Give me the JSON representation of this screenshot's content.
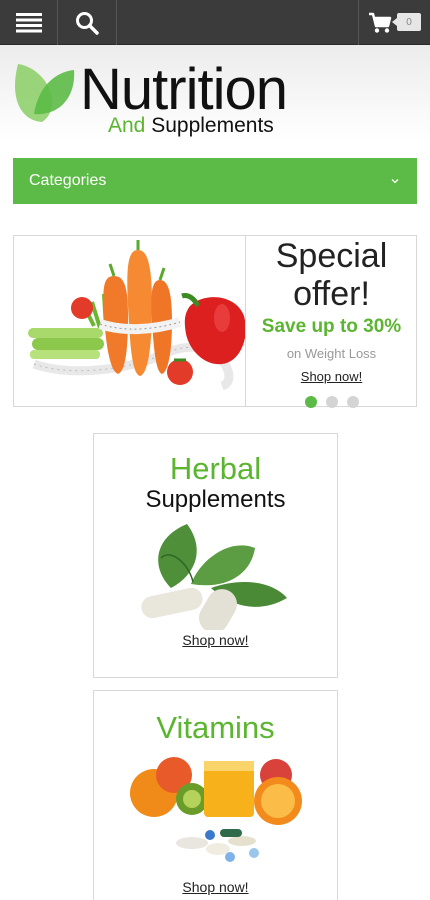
{
  "topbar": {
    "menu_icon": "hamburger-menu-icon",
    "search_icon": "search-icon",
    "cart_icon": "shopping-cart-icon",
    "cart_count": "0"
  },
  "logo": {
    "title": "Nutrition",
    "subtitle_green": "And",
    "subtitle_dark": " Supplements",
    "leaf_icon": "leaf-logo-icon"
  },
  "categories": {
    "label": "Categories",
    "icon": "chevron-down-icon"
  },
  "offer": {
    "title_line1": "Special",
    "title_line2": "offer!",
    "save": "Save up to 30%",
    "note": "on Weight Loss",
    "link": "Shop now!",
    "slides_total": 3,
    "active_slide": 1
  },
  "cards": [
    {
      "title_green": "Herbal",
      "title_dark": "Supplements",
      "link": "Shop now!"
    },
    {
      "title_green": "Vitamins",
      "link": "Shop now!"
    }
  ],
  "colors": {
    "accent_green": "#5cbb46",
    "text_green": "#5cb531",
    "topbar_bg": "#3b3b3b"
  }
}
